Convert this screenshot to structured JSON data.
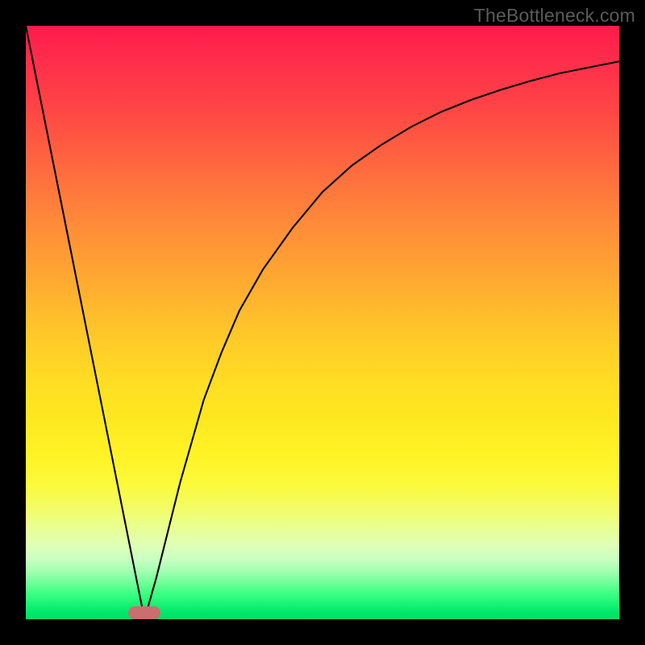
{
  "watermark": "TheBottleneck.com",
  "colors": {
    "frame": "#000000",
    "curve": "#000000",
    "marker": "#cb6e6f",
    "gradient_top": "#ff1a4b",
    "gradient_bottom": "#00de65"
  },
  "chart_data": {
    "type": "line",
    "title": "",
    "xlabel": "",
    "ylabel": "",
    "xlim": [
      0,
      100
    ],
    "ylim": [
      0,
      100
    ],
    "grid": false,
    "series": [
      {
        "name": "left-linear-segment",
        "x": [
          0,
          20
        ],
        "y": [
          100,
          0
        ]
      },
      {
        "name": "right-curve-segment",
        "x": [
          20,
          22,
          24,
          26,
          28,
          30,
          33,
          36,
          40,
          45,
          50,
          55,
          60,
          65,
          70,
          75,
          80,
          85,
          90,
          95,
          100
        ],
        "y": [
          0,
          7,
          15,
          23,
          30,
          37,
          45,
          52,
          59,
          66,
          72,
          76.5,
          80,
          83,
          85.5,
          87.5,
          89.2,
          90.7,
          92,
          93,
          94
        ]
      }
    ],
    "marker": {
      "x_center": 20,
      "x_halfwidth": 2.7,
      "y": 0,
      "height": 2.2
    },
    "legend": null,
    "annotations": []
  }
}
